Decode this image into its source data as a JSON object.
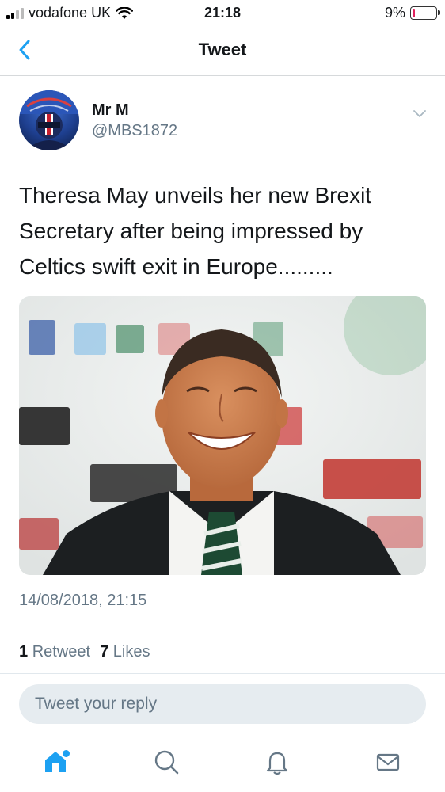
{
  "status_bar": {
    "carrier": "vodafone UK",
    "time": "21:18",
    "battery_percent_label": "9%",
    "battery_level": 0.09
  },
  "nav": {
    "title": "Tweet"
  },
  "tweet": {
    "author": {
      "display_name": "Mr M",
      "handle": "@MBS1872"
    },
    "text": "Theresa May unveils her new Brexit Secretary after being impressed by Celtics swift exit in Europe.........",
    "timestamp": "14/08/2018, 21:15",
    "stats": {
      "retweets_count": "1",
      "retweets_label": "Retweet",
      "likes_count": "7",
      "likes_label": "Likes"
    }
  },
  "reply": {
    "placeholder": "Tweet your reply"
  },
  "tabs": [
    "home-icon",
    "search-icon",
    "notifications-icon",
    "messages-icon"
  ],
  "colors": {
    "accent": "#1da1f2",
    "text_secondary": "#657786",
    "battery_low": "#e0245e"
  }
}
